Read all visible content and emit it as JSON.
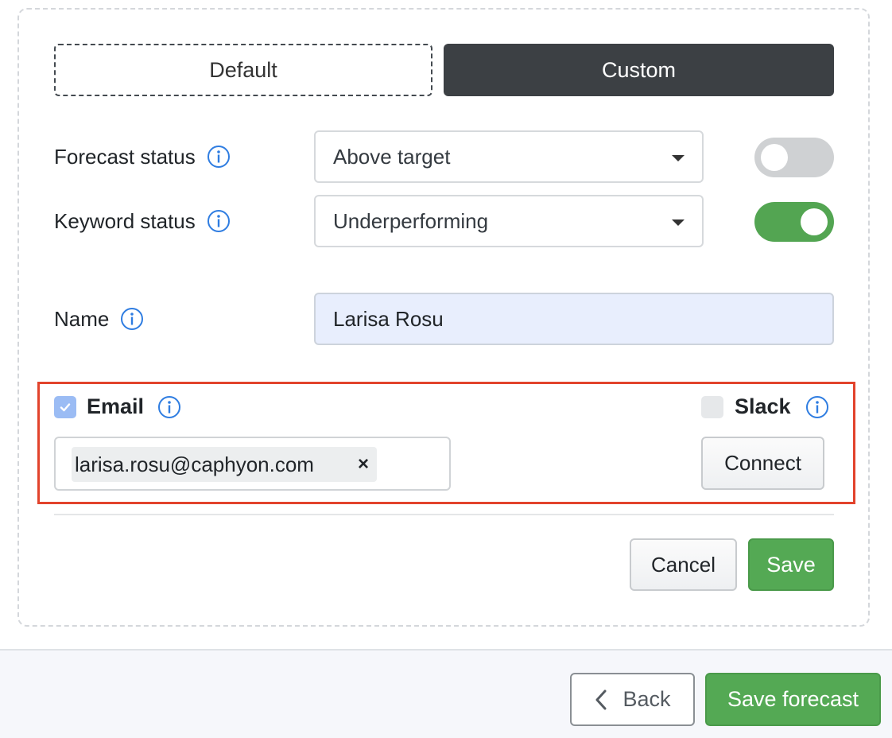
{
  "mode_toggle": {
    "default_label": "Default",
    "custom_label": "Custom",
    "selected": "Custom"
  },
  "forecast_status": {
    "label": "Forecast status",
    "value": "Above target",
    "enabled": false
  },
  "keyword_status": {
    "label": "Keyword status",
    "value": "Underperforming",
    "enabled": true
  },
  "name": {
    "label": "Name",
    "value": "Larisa Rosu"
  },
  "notifications": {
    "email": {
      "label": "Email",
      "checked": true,
      "addresses": [
        "larisa.rosu@caphyon.com"
      ],
      "remove_glyph": "×"
    },
    "slack": {
      "label": "Slack",
      "checked": false,
      "connect_label": "Connect"
    }
  },
  "actions": {
    "cancel_label": "Cancel",
    "save_label": "Save"
  },
  "footer": {
    "back_label": "Back",
    "save_forecast_label": "Save forecast"
  },
  "colors": {
    "accent_green": "#54a954",
    "dark_segment": "#3c4044",
    "info_blue": "#2f7de1",
    "highlight_red": "#e2432c"
  },
  "icons": [
    "info-icon",
    "caret-down-icon",
    "check-icon",
    "close-icon",
    "chevron-left-icon"
  ]
}
